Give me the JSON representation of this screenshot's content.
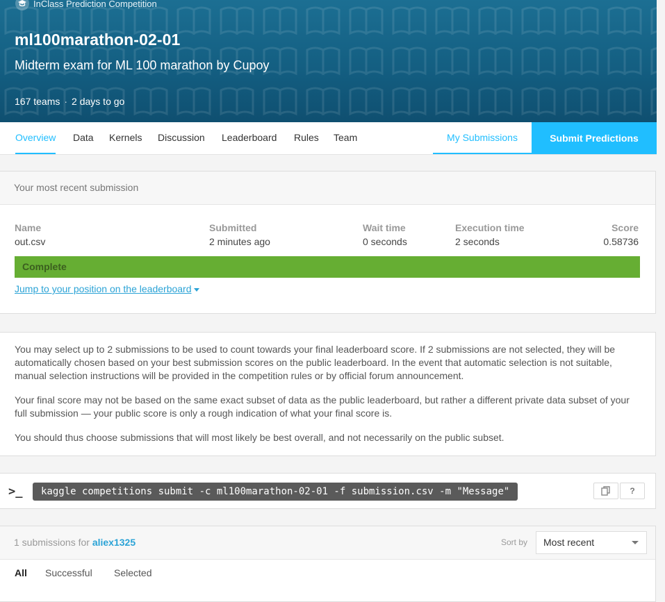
{
  "competition": {
    "type_label": "InClass Prediction Competition",
    "title": "ml100marathon-02-01",
    "subtitle": "Midterm exam for ML 100 marathon by Cupoy",
    "teams": "167 teams",
    "deadline": "2 days to go"
  },
  "nav": {
    "items": [
      {
        "label": "Overview",
        "active": true
      },
      {
        "label": "Data"
      },
      {
        "label": "Kernels"
      },
      {
        "label": "Discussion"
      },
      {
        "label": "Leaderboard"
      },
      {
        "label": "Rules"
      },
      {
        "label": "Team"
      }
    ],
    "my_submissions": "My Submissions",
    "submit_predictions": "Submit Predictions"
  },
  "recent": {
    "header": "Your most recent submission",
    "columns": {
      "name": {
        "label": "Name",
        "value": "out.csv"
      },
      "submitted": {
        "label": "Submitted",
        "value": "2 minutes ago"
      },
      "wait": {
        "label": "Wait time",
        "value": "0 seconds"
      },
      "execution": {
        "label": "Execution time",
        "value": "2 seconds"
      },
      "score": {
        "label": "Score",
        "value": "0.58736"
      }
    },
    "status": "Complete",
    "status_color": "#66ae33",
    "jump_link": "Jump to your position on the leaderboard"
  },
  "info": {
    "p1": "You may select up to 2 submissions to be used to count towards your final leaderboard score. If 2 submissions are not selected, they will be automatically chosen based on your best submission scores on the public leaderboard. In the event that automatic selection is not suitable, manual selection instructions will be provided in the competition rules or by official forum announcement.",
    "p2": "Your final score may not be based on the same exact subset of data as the public leaderboard, but rather a different private data subset of your full submission — your public score is only a rough indication of what your final score is.",
    "p3": "You should thus choose submissions that will most likely be best overall, and not necessarily on the public subset."
  },
  "cli": {
    "prompt": ">_",
    "command": "kaggle competitions submit -c ml100marathon-02-01 -f submission.csv -m \"Message\"",
    "help": "?"
  },
  "submissions": {
    "count_text": "1 submissions for",
    "user": "aliex1325",
    "sort_label": "Sort by",
    "sort_value": "Most recent",
    "tabs": [
      "All",
      "Successful",
      "Selected"
    ]
  },
  "colors": {
    "brand": "#20beff",
    "banner": "#135d80",
    "link": "#2ba3d6"
  }
}
